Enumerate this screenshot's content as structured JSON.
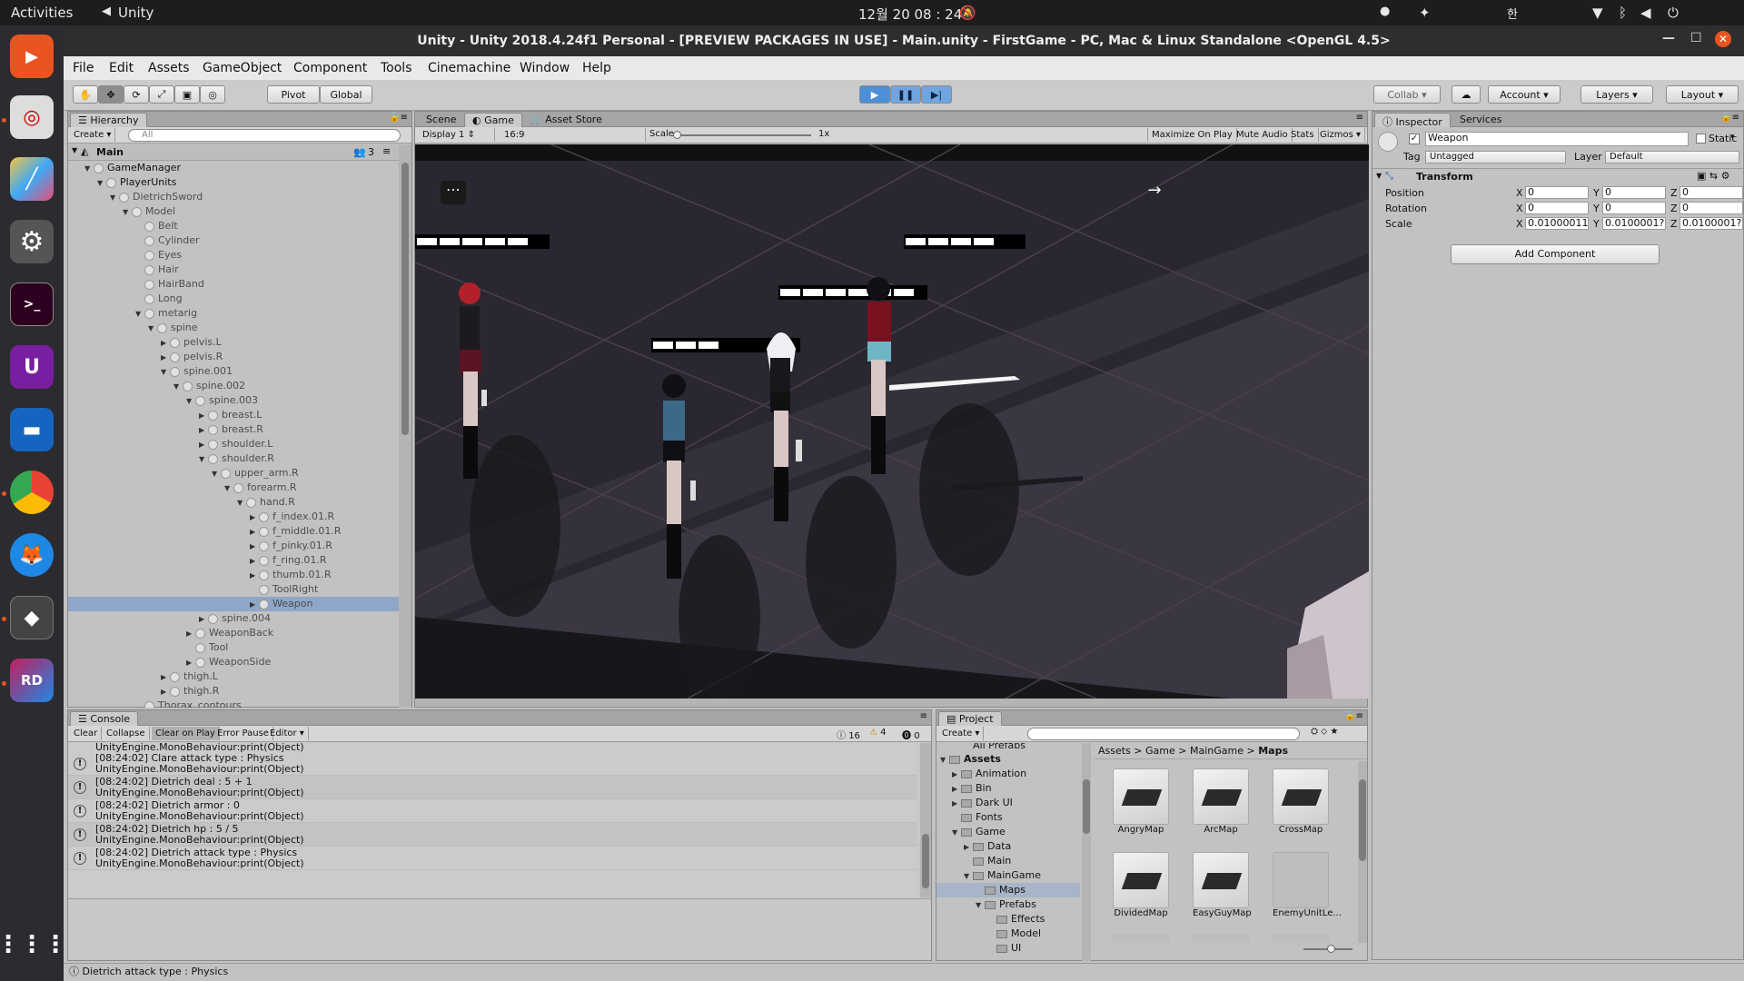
{
  "topbar": {
    "activities": "Activities",
    "app": "Unity",
    "clock": "12월 20  08 : 24",
    "lang": "한"
  },
  "window": {
    "title": "Unity - Unity 2018.4.24f1 Personal - [PREVIEW PACKAGES IN USE] - Main.unity - FirstGame - PC, Mac & Linux Standalone <OpenGL 4.5>"
  },
  "menu": [
    "File",
    "Edit",
    "Assets",
    "GameObject",
    "Component",
    "Tools",
    "Cinemachine",
    "Window",
    "Help"
  ],
  "toolbar": {
    "pivot": "Pivot",
    "global": "Global",
    "collab": "Collab",
    "account": "Account",
    "layers": "Layers",
    "layout": "Layout"
  },
  "hierarchy": {
    "tab": "Hierarchy",
    "create": "Create",
    "search": "All",
    "scene": "Main",
    "count": "3",
    "items": [
      {
        "label": "GameManager",
        "depth": 1,
        "open": true
      },
      {
        "label": "PlayerUnits",
        "depth": 2,
        "open": true
      },
      {
        "label": "DietrichSword",
        "depth": 3,
        "open": true,
        "dim": true
      },
      {
        "label": "Model",
        "depth": 4,
        "open": true,
        "dim": true
      },
      {
        "label": "Belt",
        "depth": 5,
        "dim": true
      },
      {
        "label": "Cylinder",
        "depth": 5,
        "dim": true
      },
      {
        "label": "Eyes",
        "depth": 5,
        "dim": true
      },
      {
        "label": "Hair",
        "depth": 5,
        "dim": true
      },
      {
        "label": "HairBand",
        "depth": 5,
        "dim": true
      },
      {
        "label": "Long",
        "depth": 5,
        "dim": true
      },
      {
        "label": "metarig",
        "depth": 5,
        "open": true,
        "dim": true
      },
      {
        "label": "spine",
        "depth": 6,
        "open": true,
        "dim": true
      },
      {
        "label": "pelvis.L",
        "depth": 7,
        "closed": true,
        "dim": true
      },
      {
        "label": "pelvis.R",
        "depth": 7,
        "closed": true,
        "dim": true
      },
      {
        "label": "spine.001",
        "depth": 7,
        "open": true,
        "dim": true
      },
      {
        "label": "spine.002",
        "depth": 8,
        "open": true,
        "dim": true
      },
      {
        "label": "spine.003",
        "depth": 9,
        "open": true,
        "dim": true
      },
      {
        "label": "breast.L",
        "depth": 10,
        "closed": true,
        "dim": true
      },
      {
        "label": "breast.R",
        "depth": 10,
        "closed": true,
        "dim": true
      },
      {
        "label": "shoulder.L",
        "depth": 10,
        "closed": true,
        "dim": true
      },
      {
        "label": "shoulder.R",
        "depth": 10,
        "open": true,
        "dim": true
      },
      {
        "label": "upper_arm.R",
        "depth": 11,
        "open": true,
        "dim": true
      },
      {
        "label": "forearm.R",
        "depth": 12,
        "open": true,
        "dim": true
      },
      {
        "label": "hand.R",
        "depth": 13,
        "open": true,
        "dim": true
      },
      {
        "label": "f_index.01.R",
        "depth": 14,
        "closed": true,
        "dim": true
      },
      {
        "label": "f_middle.01.R",
        "depth": 14,
        "closed": true,
        "dim": true
      },
      {
        "label": "f_pinky.01.R",
        "depth": 14,
        "closed": true,
        "dim": true
      },
      {
        "label": "f_ring.01.R",
        "depth": 14,
        "closed": true,
        "dim": true
      },
      {
        "label": "thumb.01.R",
        "depth": 14,
        "closed": true,
        "dim": true
      },
      {
        "label": "ToolRight",
        "depth": 14,
        "dim": true
      },
      {
        "label": "Weapon",
        "depth": 14,
        "closed": true,
        "dim": true,
        "selected": true
      },
      {
        "label": "spine.004",
        "depth": 10,
        "closed": true,
        "dim": true
      },
      {
        "label": "WeaponBack",
        "depth": 9,
        "closed": true,
        "dim": true
      },
      {
        "label": "Tool",
        "depth": 9,
        "dim": true
      },
      {
        "label": "WeaponSide",
        "depth": 9,
        "closed": true,
        "dim": true
      },
      {
        "label": "thigh.L",
        "depth": 7,
        "closed": true,
        "dim": true
      },
      {
        "label": "thigh.R",
        "depth": 7,
        "closed": true,
        "dim": true
      },
      {
        "label": "Thorax_contours",
        "depth": 5,
        "dim": true
      }
    ]
  },
  "center": {
    "tabs": [
      "Scene",
      "Game",
      "Asset Store"
    ],
    "display": "Display 1",
    "aspect": "16:9",
    "scale_label": "Scale",
    "scale_value": "1x",
    "maximize": "Maximize On Play",
    "mute": "Mute Audio",
    "stats": "Stats",
    "gizmos": "Gizmos",
    "menu_dots": "⋯",
    "arrow": "→",
    "hpbars": [
      {
        "segments": 5
      },
      {
        "segments": 4
      },
      {
        "segments": 6
      },
      {
        "segments": 3
      }
    ]
  },
  "inspector": {
    "tab": "Inspector",
    "services": "Services",
    "name": "Weapon",
    "static": "Static",
    "tag_label": "Tag",
    "tag": "Untagged",
    "layer_label": "Layer",
    "layer": "Default",
    "component": "Transform",
    "rows": [
      {
        "label": "Position",
        "x": "0",
        "y": "0",
        "z": "0"
      },
      {
        "label": "Rotation",
        "x": "0",
        "y": "0",
        "z": "0"
      },
      {
        "label": "Scale",
        "x": "0.01000011",
        "y": "0.0100001?",
        "z": "0.0100001?"
      }
    ],
    "add": "Add Component"
  },
  "console": {
    "tab": "Console",
    "buttons": [
      "Clear",
      "Collapse",
      "Clear on Play",
      "Error Pause",
      "Editor"
    ],
    "info": "16",
    "warn": "4",
    "err": "0",
    "top": "UnityEngine.MonoBehaviour:print(Object)",
    "logs": [
      {
        "line1": "[08:24:02] Clare attack type : Physics",
        "line2": "UnityEngine.MonoBehaviour:print(Object)"
      },
      {
        "line1": "[08:24:02] Dietrich deal : 5 + 1",
        "line2": "UnityEngine.MonoBehaviour:print(Object)"
      },
      {
        "line1": "[08:24:02] Dietrich armor : 0",
        "line2": "UnityEngine.MonoBehaviour:print(Object)"
      },
      {
        "line1": "[08:24:02] Dietrich hp : 5 / 5",
        "line2": "UnityEngine.MonoBehaviour:print(Object)"
      },
      {
        "line1": "[08:24:02] Dietrich attack type : Physics",
        "line2": "UnityEngine.MonoBehaviour:print(Object)"
      }
    ]
  },
  "project": {
    "tab": "Project",
    "create": "Create",
    "top": "All Prefabs",
    "tree": [
      {
        "label": "Assets",
        "depth": 0,
        "open": true
      },
      {
        "label": "Animation",
        "depth": 1,
        "closed": true
      },
      {
        "label": "Bin",
        "depth": 1,
        "closed": true
      },
      {
        "label": "Dark UI",
        "depth": 1,
        "closed": true
      },
      {
        "label": "Fonts",
        "depth": 1
      },
      {
        "label": "Game",
        "depth": 1,
        "open": true
      },
      {
        "label": "Data",
        "depth": 2,
        "closed": true
      },
      {
        "label": "Main",
        "depth": 2
      },
      {
        "label": "MainGame",
        "depth": 2,
        "open": true
      },
      {
        "label": "Maps",
        "depth": 3,
        "selected": true
      },
      {
        "label": "Prefabs",
        "depth": 3,
        "open": true
      },
      {
        "label": "Effects",
        "depth": 4
      },
      {
        "label": "Model",
        "depth": 4
      },
      {
        "label": "UI",
        "depth": 4
      }
    ],
    "breadcrumb": [
      "Assets",
      "Game",
      "MainGame",
      "Maps"
    ],
    "files": [
      "AngryMap",
      "ArcMap",
      "CrossMap",
      "DividedMap",
      "EasyGuyMap",
      "EnemyUnitLe..."
    ]
  },
  "status": "Dietrich attack type : Physics"
}
